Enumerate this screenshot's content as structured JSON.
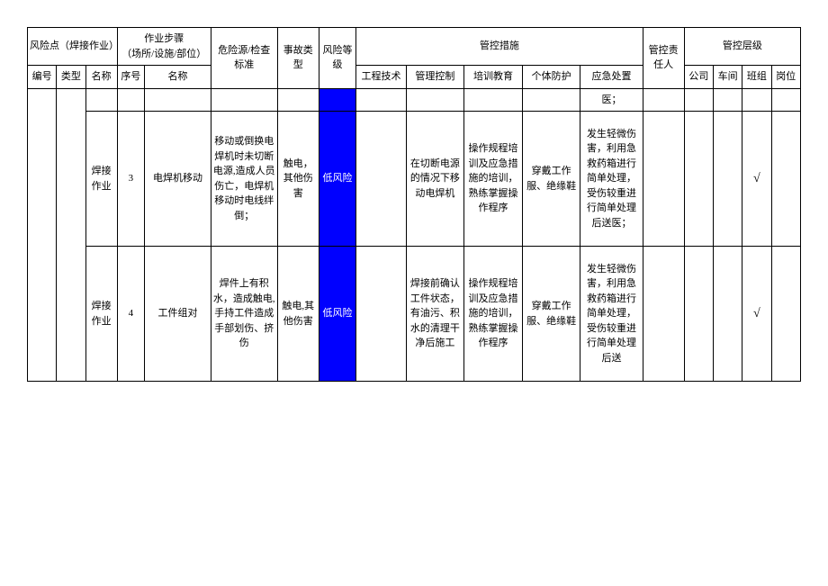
{
  "header": {
    "group_risk_point": "风险点（焊接作业）",
    "group_step": "作业步骤\n（场所/设施/部位）",
    "hazard": "危险源/检查标准",
    "accident_type": "事故类型",
    "risk_level": "风险等级",
    "group_control": "管控措施",
    "responsible": "管控责任人",
    "group_control_level": "管控层级",
    "sub": {
      "id": "编号",
      "type": "类型",
      "name": "名称",
      "seq": "序号",
      "step_name": "名称",
      "eng": "工程技术",
      "mgmt": "管理控制",
      "train": "培训教育",
      "ppe": "个体防护",
      "emer": "应急处置",
      "company": "公司",
      "workshop": "车间",
      "team": "班组",
      "post": "岗位"
    }
  },
  "carryover": {
    "emer_tail": "医；"
  },
  "rows": [
    {
      "name": "焊接作业",
      "seq": "3",
      "step": "电焊机移动",
      "hazard": "移动或倒换电焊机时未切断电源,造成人员伤亡，电焊机移动时电线绊倒；",
      "accident": "触电，其他伤害",
      "risk": "低风险",
      "eng": "",
      "mgmt": "在切断电源的情况下移动电焊机",
      "train": "操作规程培训及应急措施的培训，熟练掌握操作程序",
      "ppe": "穿戴工作服、绝缘鞋",
      "emer": "发生轻微伤害，利用急救药箱进行简单处理，受伤较重进行简单处理后送医；",
      "resp": "",
      "company": "",
      "workshop": "",
      "team": "√",
      "post": ""
    },
    {
      "name": "焊接作业",
      "seq": "4",
      "step": "工件组对",
      "hazard": "焊件上有积水，造成触电,手持工件造成手部划伤、挤伤",
      "accident": "触电,其他伤害",
      "risk": "低风险",
      "eng": "",
      "mgmt": "焊接前确认工件状态，有油污、积水的清理干净后施工",
      "train": "操作规程培训及应急措施的培训，熟练掌握操作程序",
      "ppe": "穿戴工作服、绝缘鞋",
      "emer": "发生轻微伤害，利用急救药箱进行简单处理，受伤较重进行简单处理后送",
      "resp": "",
      "company": "",
      "workshop": "",
      "team": "√",
      "post": ""
    }
  ]
}
